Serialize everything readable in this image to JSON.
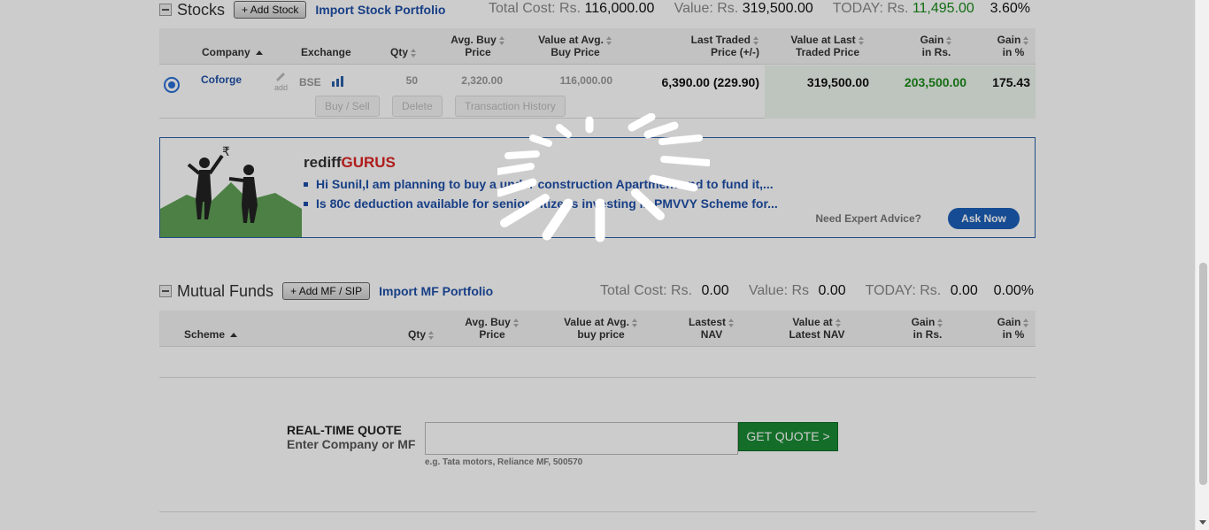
{
  "stocks": {
    "title": "Stocks",
    "add_label": "+ Add Stock",
    "import_label": "Import Stock Portfolio",
    "summary": {
      "total_cost_label": "Total Cost: Rs.",
      "total_cost_value": "116,000.00",
      "value_label": "Value: Rs.",
      "value_value": "319,500.00",
      "today_label": "TODAY: Rs.",
      "today_value": "11,495.00",
      "today_pct": "3.60%"
    },
    "columns": {
      "company": "Company",
      "exchange": "Exchange",
      "qty": "Qty",
      "avg_buy_1": "Avg. Buy",
      "avg_buy_2": "Price",
      "value_avg_1": "Value at Avg.",
      "value_avg_2": "Buy Price",
      "last_traded_1": "Last Traded",
      "last_traded_2": "Price (+/-)",
      "value_last_1": "Value at Last",
      "value_last_2": "Traded Price",
      "gain_rs_1": "Gain",
      "gain_rs_2": "in Rs.",
      "gain_pct_1": "Gain",
      "gain_pct_2": "in %"
    },
    "rows": [
      {
        "company": "Coforge",
        "edit_label": "add",
        "exchange": "BSE",
        "qty": "50",
        "avg_buy": "2,320.00",
        "value_avg": "116,000.00",
        "last_traded": "6,390.00 (229.90)",
        "value_last": "319,500.00",
        "gain_rs": "203,500.00",
        "gain_pct": "175.43",
        "actions": {
          "buy_sell": "Buy / Sell",
          "delete": "Delete",
          "history": "Transaction History"
        }
      }
    ]
  },
  "gurus": {
    "brand_prefix": "rediff",
    "brand_suffix": "GURUS",
    "questions": [
      "Hi Sunil,I am planning to buy a under construction Apartment and to fund it,...",
      "Is 80c deduction available for senior citizens investing in PMVVY Scheme for..."
    ],
    "advice_label": "Need Expert Advice?",
    "ask_label": "Ask Now"
  },
  "mutual_funds": {
    "title": "Mutual Funds",
    "add_label": "+ Add MF / SIP",
    "import_label": "Import MF Portfolio",
    "summary": {
      "total_cost_label": "Total Cost: Rs.",
      "total_cost_value": "0.00",
      "value_label": "Value: Rs",
      "value_value": "0.00",
      "today_label": "TODAY: Rs.",
      "today_value": "0.00",
      "today_pct": "0.00%"
    },
    "columns": {
      "scheme": "Scheme",
      "qty": "Qty",
      "avg_buy_1": "Avg. Buy",
      "avg_buy_2": "Price",
      "value_avg_1": "Value at Avg.",
      "value_avg_2": "buy price",
      "nav_1": "Lastest",
      "nav_2": "NAV",
      "value_nav_1": "Value at",
      "value_nav_2": "Latest NAV",
      "gain_rs_1": "Gain",
      "gain_rs_2": "in Rs.",
      "gain_pct_1": "Gain",
      "gain_pct_2": "in %"
    }
  },
  "quote": {
    "title": "REAL-TIME QUOTE",
    "subtitle": "Enter Company or MF",
    "input_value": "",
    "button_label": "GET QUOTE >",
    "example": "e.g. Tata motors, Reliance MF, 500570"
  },
  "colors": {
    "link": "#1e4fa8",
    "gain": "#1a8a1a",
    "quote_button": "#1a8a34",
    "ask_button": "#1c5fb8",
    "gurus_accent": "#d22222"
  },
  "icons": {
    "collapse": "minus-square-icon",
    "edit": "pencil-icon",
    "chart": "bar-chart-icon",
    "loading": "spinner-icon"
  }
}
